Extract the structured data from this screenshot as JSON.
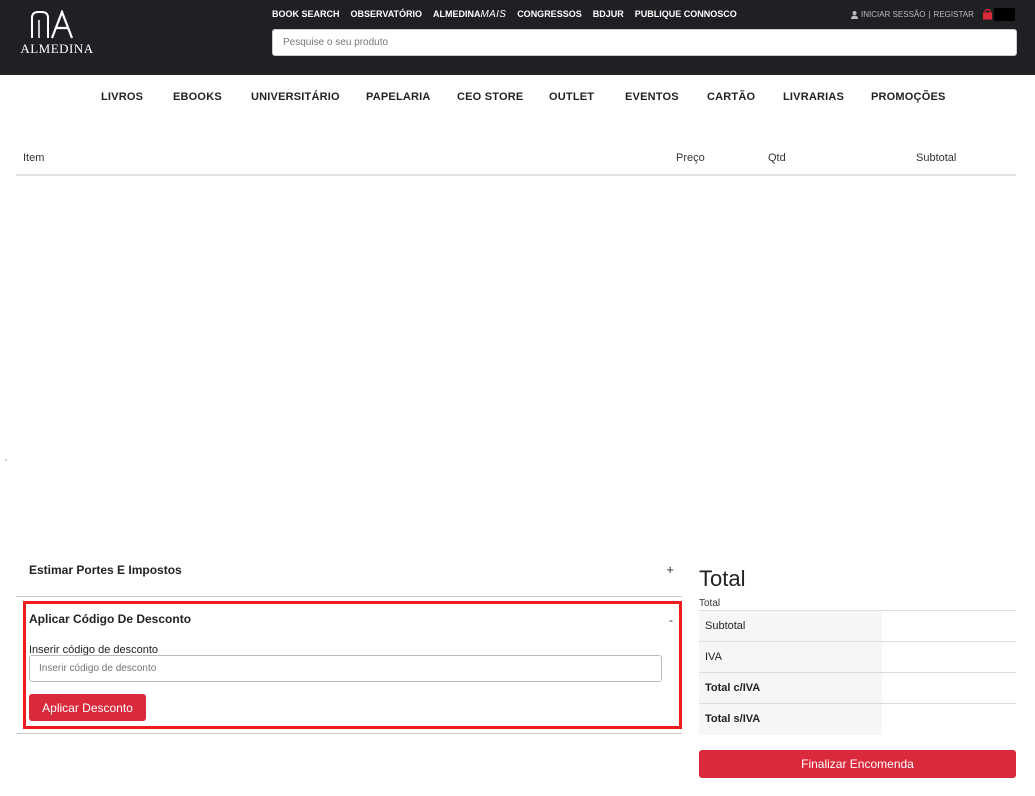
{
  "header": {
    "logo_text": "ALMEDINA",
    "top_links": [
      {
        "label": "BOOK SEARCH"
      },
      {
        "label": "OBSERVATÓRIO"
      },
      {
        "label": "ALMEDINA",
        "suffix": "MAIS"
      },
      {
        "label": "CONGRESSOS"
      },
      {
        "label": "BDJUR"
      },
      {
        "label": "PUBLIQUE CONNOSCO"
      }
    ],
    "account": {
      "login": "INICIAR SESSÃO",
      "separator": " | ",
      "register": "REGISTAR"
    },
    "search": {
      "placeholder": "Pesquise o seu produto"
    }
  },
  "main_nav": [
    {
      "label": "LIVROS"
    },
    {
      "label": "EBOOKS"
    },
    {
      "label": "UNIVERSITÁRIO"
    },
    {
      "label": "PAPELARIA"
    },
    {
      "label": "CEO STORE"
    },
    {
      "label": "OUTLET"
    },
    {
      "label": "EVENTOS"
    },
    {
      "label": "CARTÃO"
    },
    {
      "label": "LIVRARIAS"
    },
    {
      "label": "PROMOÇÕES"
    }
  ],
  "cart_table": {
    "columns": [
      "Item",
      "Preço",
      "Qtd",
      "Subtotal"
    ]
  },
  "estimate": {
    "title": "Estimar Portes E Impostos",
    "toggle": "+"
  },
  "discount": {
    "title": "Aplicar Código De Desconto",
    "toggle": "-",
    "field_label": "Inserir código de desconto",
    "placeholder": "Inserir código de desconto",
    "button": "Aplicar Desconto"
  },
  "totals": {
    "title": "Total",
    "caption": "Total",
    "rows": [
      {
        "label": "Subtotal",
        "value": ""
      },
      {
        "label": "IVA",
        "value": ""
      },
      {
        "label": "Total c/IVA",
        "value": ""
      },
      {
        "label": "Total s/IVA",
        "value": ""
      }
    ],
    "checkout_button": "Finalizar Encomenda"
  },
  "colors": {
    "header_bg": "#1f2023",
    "accent": "#d9293a",
    "highlight": "#ee1c1c"
  }
}
